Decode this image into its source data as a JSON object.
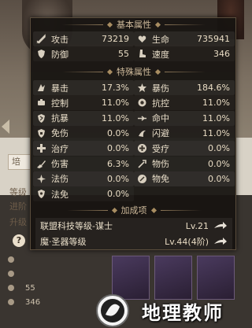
{
  "background": {
    "tab_label": "培",
    "left_labels": [
      "等级",
      "进阶",
      "升级"
    ],
    "stat_values": [
      "55",
      "346"
    ],
    "help_glyph": "?"
  },
  "popup": {
    "basic_title": "基本属性",
    "basic": [
      {
        "icon": "sword-icon",
        "label": "攻击",
        "value": "73219"
      },
      {
        "icon": "heart-icon",
        "label": "生命",
        "value": "735941"
      },
      {
        "icon": "shield-icon",
        "label": "防御",
        "value": "55"
      },
      {
        "icon": "boot-icon",
        "label": "速度",
        "value": "346"
      }
    ],
    "special_title": "特殊属性",
    "special": [
      {
        "icon": "crit-icon",
        "label": "暴击",
        "value": "17.3%"
      },
      {
        "icon": "crit-damage-icon",
        "label": "暴伤",
        "value": "184.6%"
      },
      {
        "icon": "control-icon",
        "label": "控制",
        "value": "11.0%"
      },
      {
        "icon": "resist-icon",
        "label": "抗控",
        "value": "11.0%"
      },
      {
        "icon": "anti-crit-icon",
        "label": "抗暴",
        "value": "11.0%"
      },
      {
        "icon": "accuracy-icon",
        "label": "命中",
        "value": "11.0%"
      },
      {
        "icon": "immunity-icon",
        "label": "免伤",
        "value": "0.0%"
      },
      {
        "icon": "dodge-icon",
        "label": "闪避",
        "value": "11.0%"
      },
      {
        "icon": "heal-icon",
        "label": "治疗",
        "value": "0.0%"
      },
      {
        "icon": "received-heal-icon",
        "label": "受疗",
        "value": "0.0%"
      },
      {
        "icon": "damage-icon",
        "label": "伤害",
        "value": "6.3%"
      },
      {
        "icon": "physical-damage-icon",
        "label": "物伤",
        "value": "0.0%"
      },
      {
        "icon": "magic-damage-icon",
        "label": "法伤",
        "value": "0.0%"
      },
      {
        "icon": "physical-immunity-icon",
        "label": "物免",
        "value": "0.0%"
      },
      {
        "icon": "magic-immunity-icon",
        "label": "法免",
        "value": "0.0%"
      }
    ],
    "bonus_title": "加成项",
    "bonus": [
      {
        "label": "联盟科技等级-谋士",
        "level": "Lv.21"
      },
      {
        "label": "魔·圣器等级",
        "level": "Lv.44(4阶)"
      }
    ]
  },
  "watermark": {
    "text": "地理教师"
  },
  "colors": {
    "popup_bg": "#171411",
    "title": "#cdb99a",
    "text": "#eadfca"
  }
}
